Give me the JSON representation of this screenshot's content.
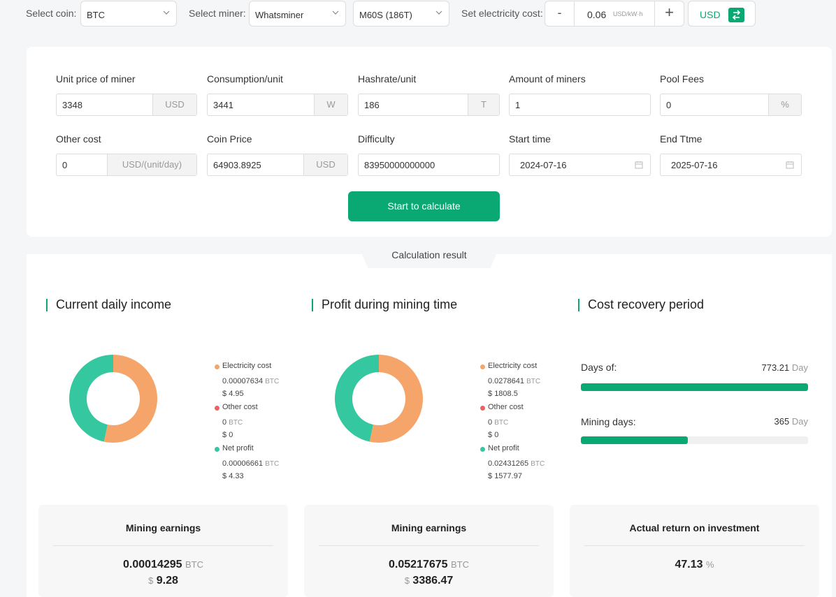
{
  "top": {
    "coin_label": "Select coin:",
    "coin_value": "BTC",
    "miner_label": "Select miner:",
    "miner_brand": "Whatsminer",
    "miner_model": "M60S (186T)",
    "electricity_label": "Set electricity cost:",
    "electricity_minus": "-",
    "electricity_plus": "+",
    "electricity_value": "0.06",
    "electricity_unit": "USD/kW·h",
    "currency": "USD"
  },
  "form": {
    "unit_price_label": "Unit price of miner",
    "unit_price_value": "3348",
    "unit_price_suffix": "USD",
    "consumption_label": "Consumption/unit",
    "consumption_value": "3441",
    "consumption_suffix": "W",
    "hashrate_label": "Hashrate/unit",
    "hashrate_value": "186",
    "hashrate_suffix": "T",
    "amount_label": "Amount of miners",
    "amount_value": "1",
    "pool_label": "Pool Fees",
    "pool_value": "0",
    "pool_suffix": "%",
    "other_label": "Other cost",
    "other_value": "0",
    "other_suffix": "USD/(unit/day)",
    "coin_price_label": "Coin Price",
    "coin_price_value": "64903.8925",
    "coin_price_suffix": "USD",
    "difficulty_label": "Difficulty",
    "difficulty_value": "83950000000000",
    "start_label": "Start time",
    "start_value": "2024-07-16",
    "end_label": "End Ttme",
    "end_value": "2025-07-16",
    "calc_button": "Start to calculate"
  },
  "result_tab": "Calculation result",
  "daily": {
    "title": "Current daily income",
    "electricity_label": "Electricity cost",
    "electricity_btc": "0.00007634",
    "electricity_usd": "4.95",
    "other_label": "Other cost",
    "other_btc": "0",
    "other_usd": "0",
    "net_label": "Net profit",
    "net_btc": "0.00006661",
    "net_usd": "4.33",
    "coin_unit": "BTC",
    "usd_symbol": "$",
    "donut_shares": [
      0.534,
      0.0,
      0.466
    ]
  },
  "period": {
    "title": "Profit during mining time",
    "electricity_label": "Electricity cost",
    "electricity_btc": "0.0278641",
    "electricity_usd": "1808.5",
    "other_label": "Other cost",
    "other_btc": "0",
    "other_usd": "0",
    "net_label": "Net profit",
    "net_btc": "0.02431265",
    "net_usd": "1577.97",
    "coin_unit": "BTC",
    "usd_symbol": "$",
    "donut_shares": [
      0.534,
      0.0,
      0.466
    ]
  },
  "recovery": {
    "title": "Cost recovery period",
    "days_label": "Days of:",
    "days_value": "773.21",
    "days_unit": "Day",
    "days_fraction": 1.0,
    "mining_label": "Mining days:",
    "mining_value": "365",
    "mining_unit": "Day",
    "mining_fraction": 0.472
  },
  "cards": {
    "c1_title": "Mining earnings",
    "c1_btc": "0.00014295",
    "c1_unit": "BTC",
    "c1_usd_symbol": "$",
    "c1_usd": "9.28",
    "c2_title": "Mining earnings",
    "c2_btc": "0.05217675",
    "c2_unit": "BTC",
    "c2_usd_symbol": "$",
    "c2_usd": "3386.47",
    "c3_title": "Actual return on investment",
    "c3_value": "47.13",
    "c3_unit": "%"
  },
  "colors": {
    "accent": "#0aa872",
    "electricity": "#f5a56a",
    "other": "#e86464",
    "net": "#34c7a0"
  },
  "icons": {
    "dropdown": "chevron-down-icon",
    "calendar": "calendar-icon",
    "swap": "swap-icon"
  }
}
